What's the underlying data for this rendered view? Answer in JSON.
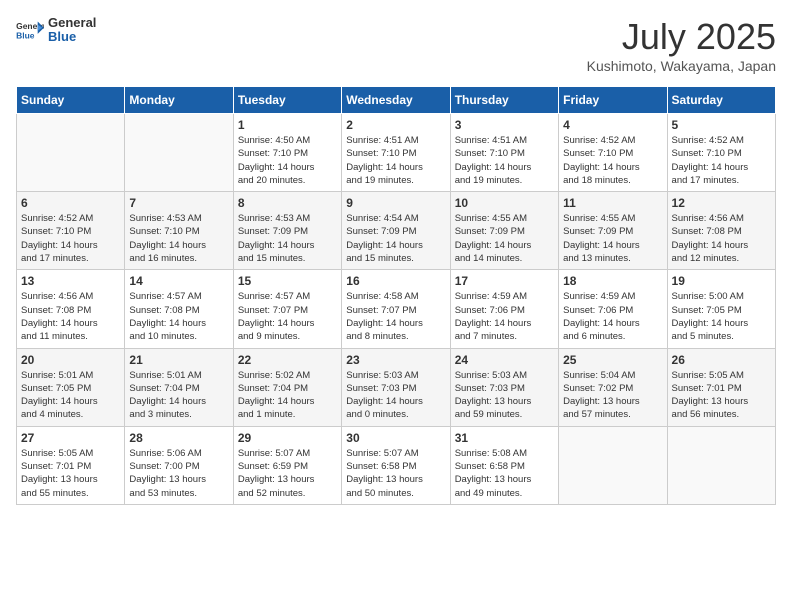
{
  "header": {
    "logo": {
      "general": "General",
      "blue": "Blue"
    },
    "title": "July 2025",
    "location": "Kushimoto, Wakayama, Japan"
  },
  "weekdays": [
    "Sunday",
    "Monday",
    "Tuesday",
    "Wednesday",
    "Thursday",
    "Friday",
    "Saturday"
  ],
  "weeks": [
    [
      {
        "day": "",
        "info": ""
      },
      {
        "day": "",
        "info": ""
      },
      {
        "day": "1",
        "info": "Sunrise: 4:50 AM\nSunset: 7:10 PM\nDaylight: 14 hours\nand 20 minutes."
      },
      {
        "day": "2",
        "info": "Sunrise: 4:51 AM\nSunset: 7:10 PM\nDaylight: 14 hours\nand 19 minutes."
      },
      {
        "day": "3",
        "info": "Sunrise: 4:51 AM\nSunset: 7:10 PM\nDaylight: 14 hours\nand 19 minutes."
      },
      {
        "day": "4",
        "info": "Sunrise: 4:52 AM\nSunset: 7:10 PM\nDaylight: 14 hours\nand 18 minutes."
      },
      {
        "day": "5",
        "info": "Sunrise: 4:52 AM\nSunset: 7:10 PM\nDaylight: 14 hours\nand 17 minutes."
      }
    ],
    [
      {
        "day": "6",
        "info": "Sunrise: 4:52 AM\nSunset: 7:10 PM\nDaylight: 14 hours\nand 17 minutes."
      },
      {
        "day": "7",
        "info": "Sunrise: 4:53 AM\nSunset: 7:10 PM\nDaylight: 14 hours\nand 16 minutes."
      },
      {
        "day": "8",
        "info": "Sunrise: 4:53 AM\nSunset: 7:09 PM\nDaylight: 14 hours\nand 15 minutes."
      },
      {
        "day": "9",
        "info": "Sunrise: 4:54 AM\nSunset: 7:09 PM\nDaylight: 14 hours\nand 15 minutes."
      },
      {
        "day": "10",
        "info": "Sunrise: 4:55 AM\nSunset: 7:09 PM\nDaylight: 14 hours\nand 14 minutes."
      },
      {
        "day": "11",
        "info": "Sunrise: 4:55 AM\nSunset: 7:09 PM\nDaylight: 14 hours\nand 13 minutes."
      },
      {
        "day": "12",
        "info": "Sunrise: 4:56 AM\nSunset: 7:08 PM\nDaylight: 14 hours\nand 12 minutes."
      }
    ],
    [
      {
        "day": "13",
        "info": "Sunrise: 4:56 AM\nSunset: 7:08 PM\nDaylight: 14 hours\nand 11 minutes."
      },
      {
        "day": "14",
        "info": "Sunrise: 4:57 AM\nSunset: 7:08 PM\nDaylight: 14 hours\nand 10 minutes."
      },
      {
        "day": "15",
        "info": "Sunrise: 4:57 AM\nSunset: 7:07 PM\nDaylight: 14 hours\nand 9 minutes."
      },
      {
        "day": "16",
        "info": "Sunrise: 4:58 AM\nSunset: 7:07 PM\nDaylight: 14 hours\nand 8 minutes."
      },
      {
        "day": "17",
        "info": "Sunrise: 4:59 AM\nSunset: 7:06 PM\nDaylight: 14 hours\nand 7 minutes."
      },
      {
        "day": "18",
        "info": "Sunrise: 4:59 AM\nSunset: 7:06 PM\nDaylight: 14 hours\nand 6 minutes."
      },
      {
        "day": "19",
        "info": "Sunrise: 5:00 AM\nSunset: 7:05 PM\nDaylight: 14 hours\nand 5 minutes."
      }
    ],
    [
      {
        "day": "20",
        "info": "Sunrise: 5:01 AM\nSunset: 7:05 PM\nDaylight: 14 hours\nand 4 minutes."
      },
      {
        "day": "21",
        "info": "Sunrise: 5:01 AM\nSunset: 7:04 PM\nDaylight: 14 hours\nand 3 minutes."
      },
      {
        "day": "22",
        "info": "Sunrise: 5:02 AM\nSunset: 7:04 PM\nDaylight: 14 hours\nand 1 minute."
      },
      {
        "day": "23",
        "info": "Sunrise: 5:03 AM\nSunset: 7:03 PM\nDaylight: 14 hours\nand 0 minutes."
      },
      {
        "day": "24",
        "info": "Sunrise: 5:03 AM\nSunset: 7:03 PM\nDaylight: 13 hours\nand 59 minutes."
      },
      {
        "day": "25",
        "info": "Sunrise: 5:04 AM\nSunset: 7:02 PM\nDaylight: 13 hours\nand 57 minutes."
      },
      {
        "day": "26",
        "info": "Sunrise: 5:05 AM\nSunset: 7:01 PM\nDaylight: 13 hours\nand 56 minutes."
      }
    ],
    [
      {
        "day": "27",
        "info": "Sunrise: 5:05 AM\nSunset: 7:01 PM\nDaylight: 13 hours\nand 55 minutes."
      },
      {
        "day": "28",
        "info": "Sunrise: 5:06 AM\nSunset: 7:00 PM\nDaylight: 13 hours\nand 53 minutes."
      },
      {
        "day": "29",
        "info": "Sunrise: 5:07 AM\nSunset: 6:59 PM\nDaylight: 13 hours\nand 52 minutes."
      },
      {
        "day": "30",
        "info": "Sunrise: 5:07 AM\nSunset: 6:58 PM\nDaylight: 13 hours\nand 50 minutes."
      },
      {
        "day": "31",
        "info": "Sunrise: 5:08 AM\nSunset: 6:58 PM\nDaylight: 13 hours\nand 49 minutes."
      },
      {
        "day": "",
        "info": ""
      },
      {
        "day": "",
        "info": ""
      }
    ]
  ]
}
